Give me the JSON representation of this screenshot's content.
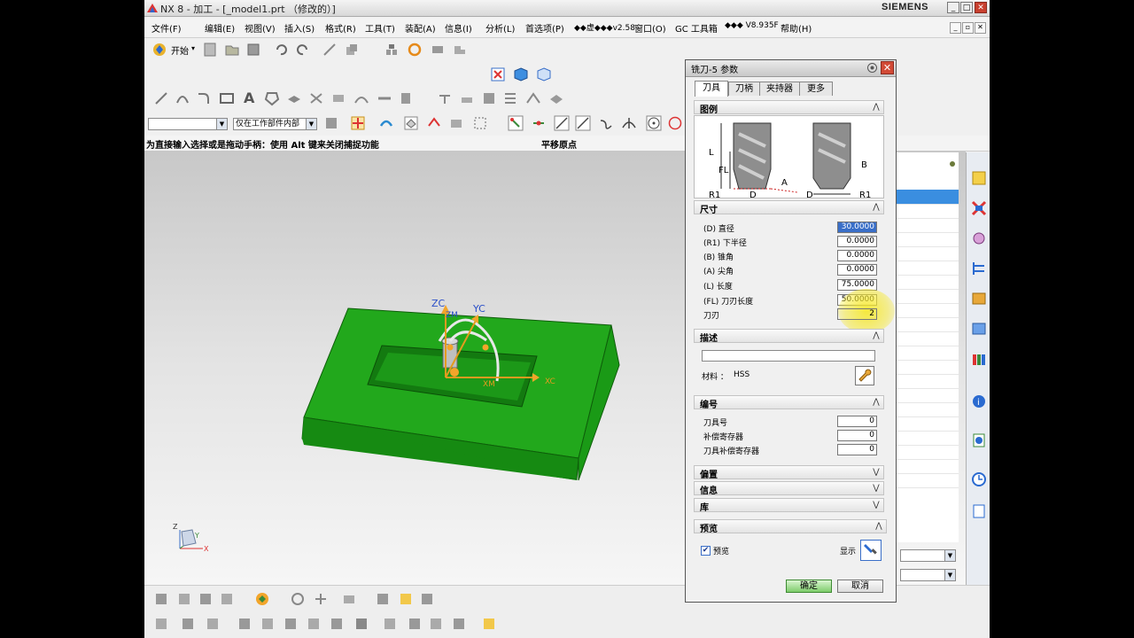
{
  "window": {
    "title": "NX 8 - 加工 - [_model1.prt （修改的）]",
    "brand": "SIEMENS",
    "minimize": "_",
    "maximize": "□",
    "close": "✕"
  },
  "menubar": {
    "start": "开始",
    "items": [
      "文件(F)",
      "编辑(E)",
      "视图(V)",
      "插入(S)",
      "格式(R)",
      "工具(T)",
      "装配(A)",
      "信息(I)",
      "分析(L)",
      "首选项(P)",
      "◆◆虚◆◆◆v2.58",
      "窗口(O)",
      "GC 工具箱",
      "◆◆◆ V8.935F",
      "帮助(H)"
    ]
  },
  "selection_bar": {
    "filter_value": "",
    "scope_value": "仅在工作部件内部"
  },
  "hint": "为直接输入选择或是拖动手柄：使用 Alt 键来关闭捕捉功能",
  "status": "平移原点",
  "viewport": {
    "axis_labels": {
      "zc": "ZC",
      "zm": "ZM",
      "yc": "YC",
      "xc": "XC",
      "xm": "XM"
    },
    "triad": {
      "z": "Z",
      "x": "X",
      "y": "Y"
    }
  },
  "dialog": {
    "title": "铣刀-5 参数",
    "tabs": [
      "刀具",
      "刀柄",
      "夹持器",
      "更多"
    ],
    "active_tab": "刀具",
    "sections": {
      "legend": "图例",
      "dimensions": "尺寸",
      "description": "描述",
      "numbering": "编号",
      "offset": "偏置",
      "info": "信息",
      "library": "库",
      "preview": "预览"
    },
    "legend_labels": [
      "L",
      "FL",
      "R1",
      "D",
      "A",
      "B",
      "D",
      "R1"
    ],
    "dimensions": [
      {
        "label": "(D) 直径",
        "value": "30.0000"
      },
      {
        "label": "(R1) 下半径",
        "value": "0.0000"
      },
      {
        "label": "(B) 锥角",
        "value": "0.0000"
      },
      {
        "label": "(A) 尖角",
        "value": "0.0000"
      },
      {
        "label": "(L) 长度",
        "value": "75.0000"
      },
      {
        "label": "(FL) 刀刃长度",
        "value": "50.0000"
      },
      {
        "label": "刀刃",
        "value": "2"
      }
    ],
    "description_value": "",
    "material_label": "材料 ：",
    "material_value": "HSS",
    "numbering": [
      {
        "label": "刀具号",
        "value": "0"
      },
      {
        "label": "补偿寄存器",
        "value": "0"
      },
      {
        "label": "刀具补偿寄存器",
        "value": "0"
      }
    ],
    "preview_check_label": "预览",
    "preview_checked": true,
    "show_label": "显示",
    "ok_label": "确定",
    "cancel_label": "取消"
  },
  "colors": {
    "part_green": "#22a81c",
    "part_dark": "#168a12",
    "highlight": "#f6e82a",
    "selection_blue": "#3a6fc8"
  }
}
